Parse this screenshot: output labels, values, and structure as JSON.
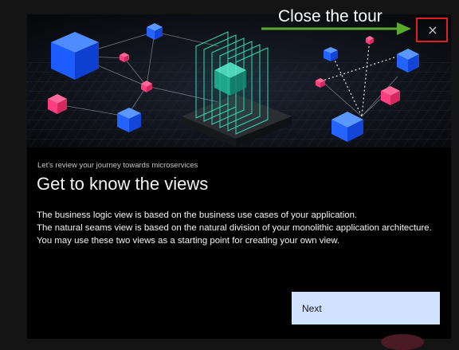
{
  "tour": {
    "subtitle": "Let's review your journey towards microservices",
    "title": "Get to know the views",
    "body": [
      "The business logic view is based on the business use cases of your application.",
      "The natural seams view is based on the natural division of your monolithic application architecture.",
      "You may use these two views as a starting point for creating your own view."
    ],
    "next_label": "Next",
    "close_glyph": "×"
  },
  "annotation": {
    "callout_text": "Close the tour",
    "arrow_color": "#5aaa32",
    "highlight_color": "#e02020"
  },
  "colors": {
    "accent_blue": "#1f6fff",
    "accent_pink": "#ff3d7f",
    "accent_teal": "#2fd8b4",
    "button_bg": "#d0e2ff"
  }
}
